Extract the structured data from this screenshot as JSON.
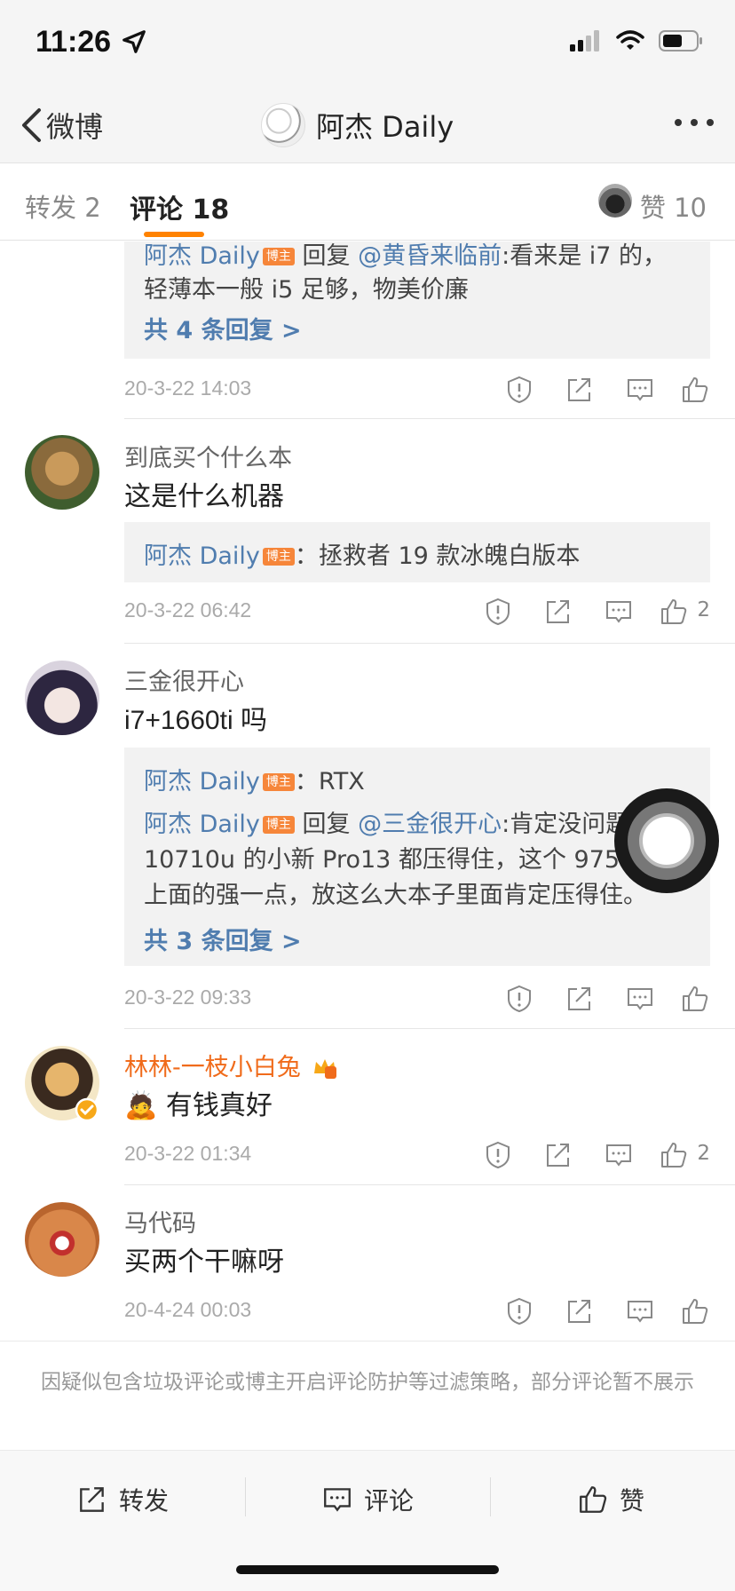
{
  "status": {
    "time": "11:26"
  },
  "nav": {
    "back_label": "微博",
    "title": "阿杰 Daily"
  },
  "tabs": {
    "repost": "转发 2",
    "comment": "评论 18",
    "like": "赞 10"
  },
  "badge_text": "博主",
  "comments": [
    {
      "reply_lines": [
        "阿杰 Daily",
        "回复 ",
        "@黄昏来临前",
        ":看来是 i7 的，",
        "轻薄本一般 i5 足够，物美价廉"
      ],
      "more_replies": "共 4 条回复 >",
      "time": "20-3-22 14:03",
      "likes": ""
    },
    {
      "user": "到底买个什么本",
      "text": "这是什么机器",
      "reply_author": "阿杰 Daily",
      "reply_text": "：拯救者 19 款冰魄白版本",
      "time": "20-3-22 06:42",
      "likes": "2"
    },
    {
      "user": "三金很开心",
      "text": "i7+1660ti 吗",
      "reply_author": "阿杰 Daily",
      "reply_text": "：RTX",
      "reply2_author": "阿杰 Daily",
      "reply2_prefix": "回复 ",
      "reply2_mention": "@三金很开心",
      "reply2_text": ":肯定没问题，",
      "reply2_line2": "10710u 的小新 Pro13 都压得住，这个 9750",
      "reply2_line3": "上面的强一点，放这么大本子里面肯定压得住。",
      "more_replies": "共 3 条回复 >",
      "time": "20-3-22 09:33",
      "likes": ""
    },
    {
      "user": "林林-一枝小白兔",
      "emoji": "🙇",
      "text": "有钱真好",
      "time": "20-3-22 01:34",
      "likes": "2"
    },
    {
      "user": "马代码",
      "text": "买两个干嘛呀",
      "time": "20-4-24 00:03",
      "likes": ""
    }
  ],
  "filter_notice": "因疑似包含垃圾评论或博主开启评论防护等过滤策略，部分评论暂不展示",
  "bottom_bar": {
    "repost": "转发",
    "comment": "评论",
    "like": "赞"
  },
  "colors": {
    "accent": "#ff8200",
    "link": "#507daf",
    "vip_name": "#f06b1b",
    "badge": "#f6863a"
  }
}
